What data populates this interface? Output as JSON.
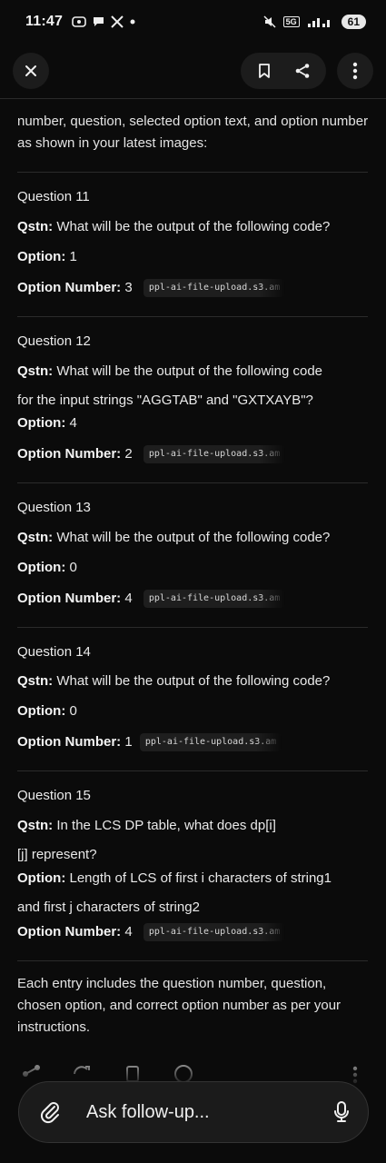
{
  "status_bar": {
    "time": "11:47",
    "left_icons": [
      "screen-record-icon",
      "chat-bubble-icon",
      "x-logo-icon",
      "notification-dot"
    ],
    "right_icons": [
      "mute-icon",
      "network-5g-icon",
      "signal-icon"
    ],
    "network_label": "5G",
    "battery": "61"
  },
  "app_bar": {
    "close_icon": "close-icon",
    "bookmark_icon": "bookmark-icon",
    "share_icon": "share-icon",
    "more_icon": "more-vertical-icon"
  },
  "intro": "number, question, selected option text, and option number as shown in your latest images:",
  "labels": {
    "qstn": "Qstn:",
    "option": "Option:",
    "option_number": "Option Number:"
  },
  "questions": [
    {
      "title": "Question 11",
      "qstn_lines": [
        "What will be the output of the following code?"
      ],
      "option_lines": [
        "1"
      ],
      "option_number": "3",
      "source": "ppl-ai-file-upload.s3.am"
    },
    {
      "title": "Question 12",
      "qstn_lines": [
        "What will be the output of the following code",
        "for the input strings \"AGGTAB\" and \"GXTXAYB\"?"
      ],
      "option_lines": [
        "4"
      ],
      "option_number": "2",
      "source": "ppl-ai-file-upload.s3.am"
    },
    {
      "title": "Question 13",
      "qstn_lines": [
        "What will be the output of the following code?"
      ],
      "option_lines": [
        "0"
      ],
      "option_number": "4",
      "source": "ppl-ai-file-upload.s3.am"
    },
    {
      "title": "Question 14",
      "qstn_lines": [
        "What will be the output of the following code?"
      ],
      "option_lines": [
        "0"
      ],
      "option_number": "1",
      "source": "ppl-ai-file-upload.s3.am"
    },
    {
      "title": "Question 15",
      "qstn_lines": [
        "In the LCS DP table, what does dp[i]",
        "[j] represent?"
      ],
      "option_lines": [
        "Length of LCS of first i characters of string1",
        "and first j characters of string2"
      ],
      "option_number": "4",
      "source": "ppl-ai-file-upload.s3.am"
    }
  ],
  "summary": "Each entry includes the question number, question, chosen option, and correct option number as per your instructions.",
  "composer": {
    "placeholder": "Ask follow-up...",
    "attach_icon": "paperclip-icon",
    "mic_icon": "microphone-icon"
  },
  "bottom_actions": [
    "share-icon",
    "rewrite-icon",
    "copy-icon",
    "search-icon",
    "more-vertical-icon"
  ]
}
